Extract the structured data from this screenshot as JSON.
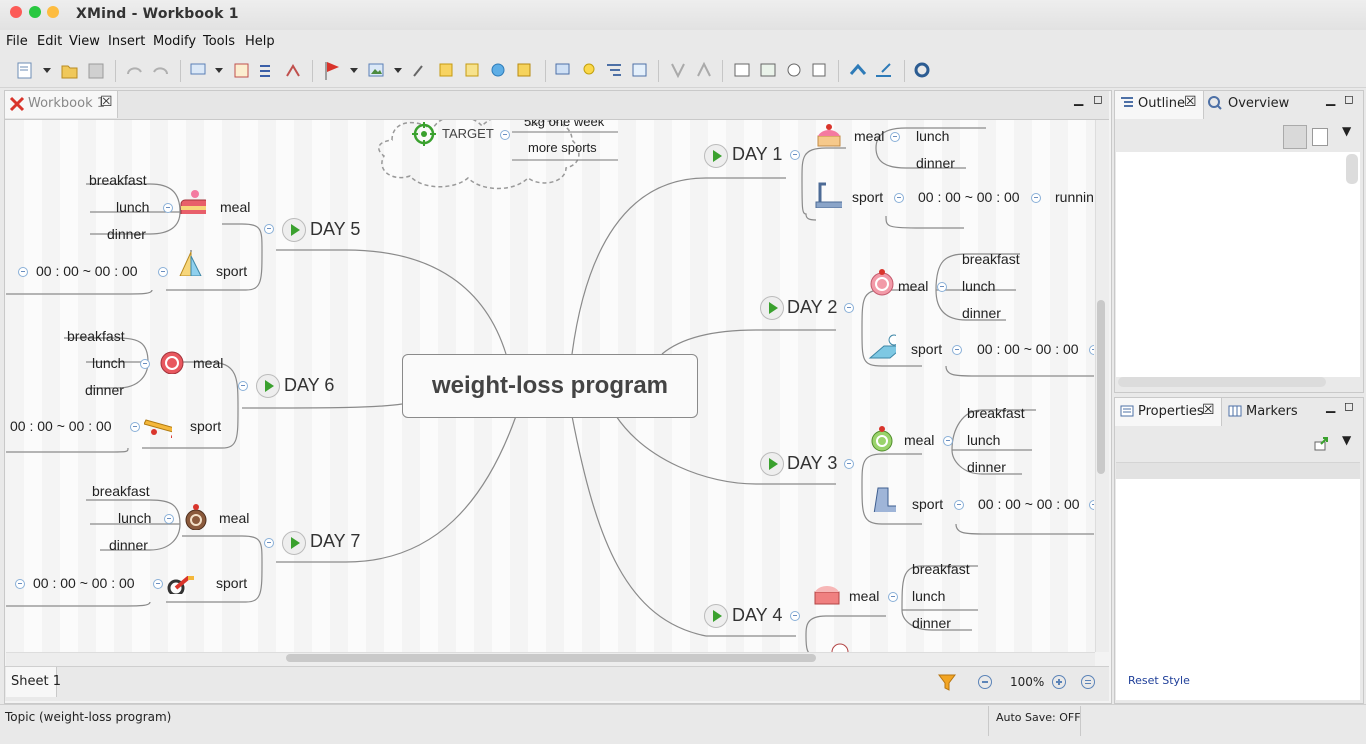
{
  "window": {
    "title": "XMind - Workbook 1"
  },
  "menu": [
    "File",
    "Edit",
    "View",
    "Insert",
    "Modify",
    "Tools",
    "Help"
  ],
  "editor": {
    "tab_label": "Workbook 1",
    "sheet_tab": "Sheet 1",
    "zoom": "100%"
  },
  "map": {
    "central": "weight-loss program",
    "target": {
      "label": "TARGET",
      "items": [
        "5kg one week",
        "more sports"
      ]
    },
    "days": [
      {
        "label": "DAY 1",
        "meal": "meal",
        "meals": [
          "lunch",
          "dinner"
        ],
        "sport": "sport",
        "time": "00 : 00 ~ 00 : 00",
        "activity": "running"
      },
      {
        "label": "DAY 2",
        "meal": "meal",
        "meals": [
          "breakfast",
          "lunch",
          "dinner"
        ],
        "sport": "sport",
        "time": "00 : 00 ~ 00 : 00"
      },
      {
        "label": "DAY 3",
        "meal": "meal",
        "meals": [
          "breakfast",
          "lunch",
          "dinner"
        ],
        "sport": "sport",
        "time": "00 : 00 ~ 00 : 00"
      },
      {
        "label": "DAY 4",
        "meal": "meal",
        "meals": [
          "breakfast",
          "lunch",
          "dinner"
        ]
      },
      {
        "label": "DAY 5",
        "meal": "meal",
        "meals": [
          "breakfast",
          "lunch",
          "dinner"
        ],
        "sport": "sport",
        "time": "00 : 00 ~ 00 : 00"
      },
      {
        "label": "DAY 6",
        "meal": "meal",
        "meals": [
          "breakfast",
          "lunch",
          "dinner"
        ],
        "sport": "sport",
        "time": "00 : 00 ~ 00 : 00"
      },
      {
        "label": "DAY 7",
        "meal": "meal",
        "meals": [
          "breakfast",
          "lunch",
          "dinner"
        ],
        "sport": "sport",
        "time": "00 : 00 ~ 00 : 00"
      }
    ]
  },
  "outline_panel": {
    "tab_outline": "Outline",
    "tab_overview": "Overview"
  },
  "properties_panel": {
    "tab_properties": "Properties",
    "tab_markers": "Markers",
    "reset_style": "Reset Style"
  },
  "status": {
    "selection": "Topic (weight-loss program)",
    "autosave": "Auto Save: OFF"
  }
}
